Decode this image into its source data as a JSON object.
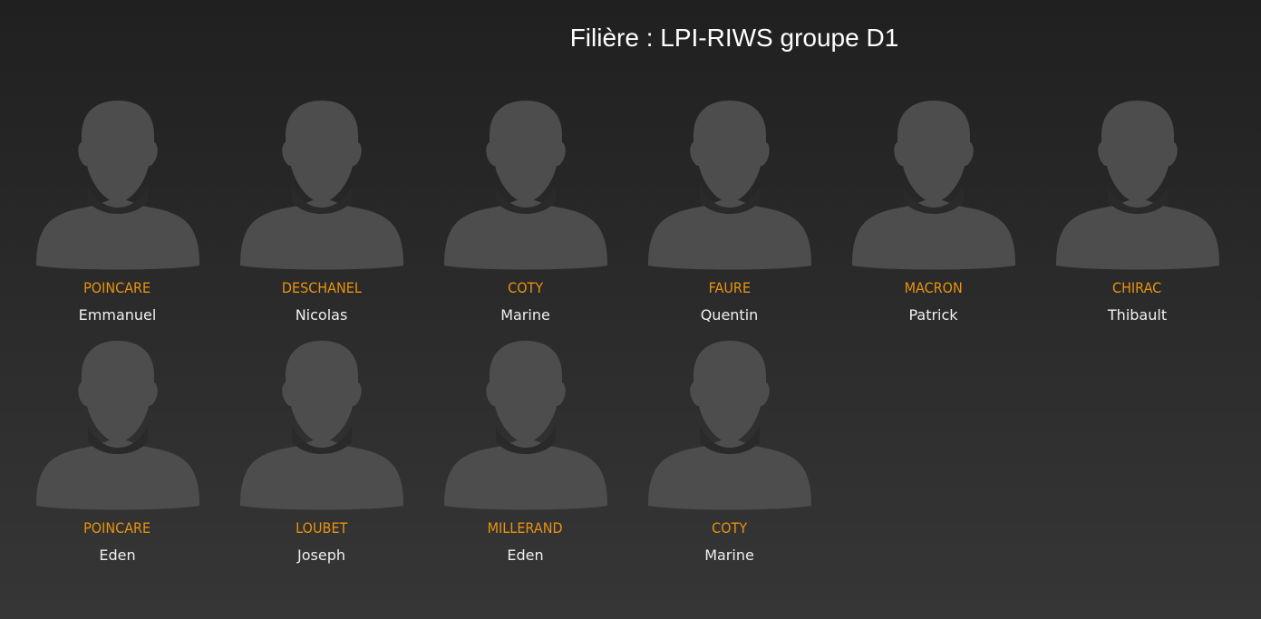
{
  "header": {
    "title": "Filière : LPI-RIWS groupe D1"
  },
  "students": [
    {
      "lastname": "POINCARE",
      "firstname": "Emmanuel",
      "avatar": "user-silhouette-icon"
    },
    {
      "lastname": "DESCHANEL",
      "firstname": "Nicolas",
      "avatar": "user-silhouette-icon"
    },
    {
      "lastname": "COTY",
      "firstname": "Marine",
      "avatar": "user-silhouette-icon"
    },
    {
      "lastname": "FAURE",
      "firstname": "Quentin",
      "avatar": "user-silhouette-icon"
    },
    {
      "lastname": "MACRON",
      "firstname": "Patrick",
      "avatar": "user-silhouette-icon"
    },
    {
      "lastname": "CHIRAC",
      "firstname": "Thibault",
      "avatar": "user-silhouette-icon"
    },
    {
      "lastname": "POINCARE",
      "firstname": "Eden",
      "avatar": "user-silhouette-icon"
    },
    {
      "lastname": "LOUBET",
      "firstname": "Joseph",
      "avatar": "user-silhouette-icon"
    },
    {
      "lastname": "MILLERAND",
      "firstname": "Eden",
      "avatar": "user-silhouette-icon"
    },
    {
      "lastname": "COTY",
      "firstname": "Marine",
      "avatar": "user-silhouette-icon"
    }
  ],
  "colors": {
    "lastname": "#e8930f",
    "firstname": "#f0f0f0",
    "silhouette": "#4d4d4d"
  }
}
